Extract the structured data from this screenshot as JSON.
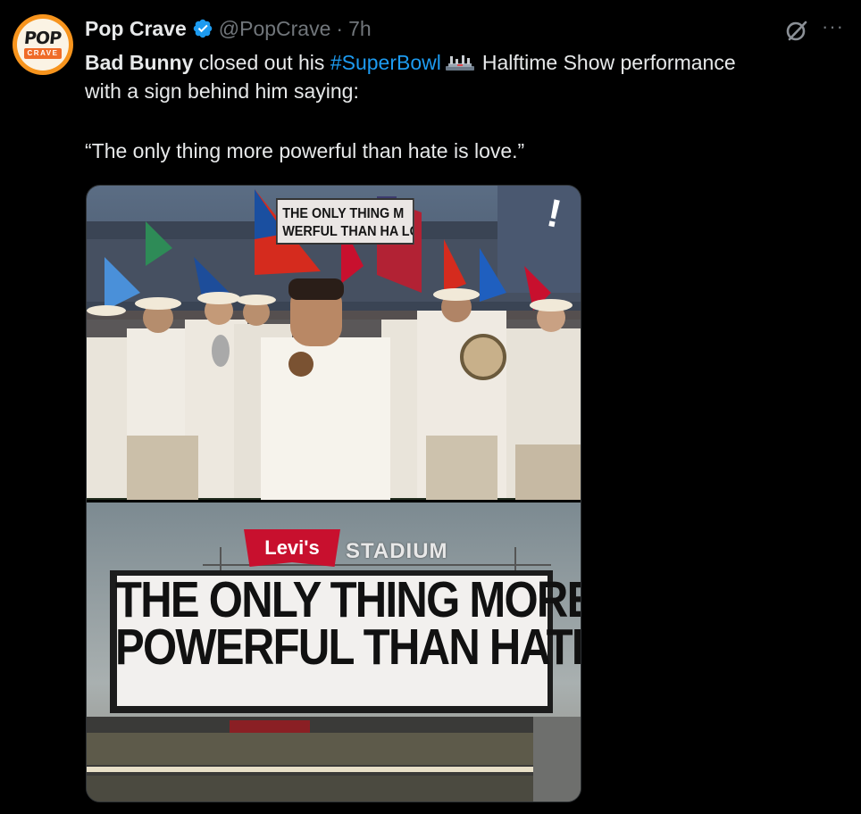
{
  "account": {
    "avatar_text_top": "POP",
    "avatar_text_bottom": "CRAVE",
    "name": "Pop Crave",
    "handle": "@PopCrave",
    "separator": "·",
    "time": "7h"
  },
  "icons": {
    "verified": "verified-badge-icon",
    "grok": "grok-icon",
    "more": "more-options-icon",
    "hashtag_emoji": "super-bowl-emoji-icon"
  },
  "colors": {
    "background": "#000000",
    "text": "#e7e9ea",
    "muted": "#71767b",
    "link": "#1d9bf0"
  },
  "tweet": {
    "artist": "Bad Bunny",
    "text_1": " closed out his ",
    "hashtag": "#SuperBowl",
    "text_2": "Halftime Show performance",
    "line_2": "with a sign behind him saying:",
    "quote": "“The only thing more powerful than hate is love.”"
  },
  "media": {
    "sign_line_1": "THE ONLY THING MORE",
    "sign_line_2": "POWERFUL THAN HATE IS LOVE",
    "brand": "Levi's",
    "stadium": "STADIUM",
    "mini_sign_line_1": "THE ONLY THING M",
    "mini_sign_line_2": "WERFUL THAN HA   LOVE"
  },
  "more_label": "···"
}
